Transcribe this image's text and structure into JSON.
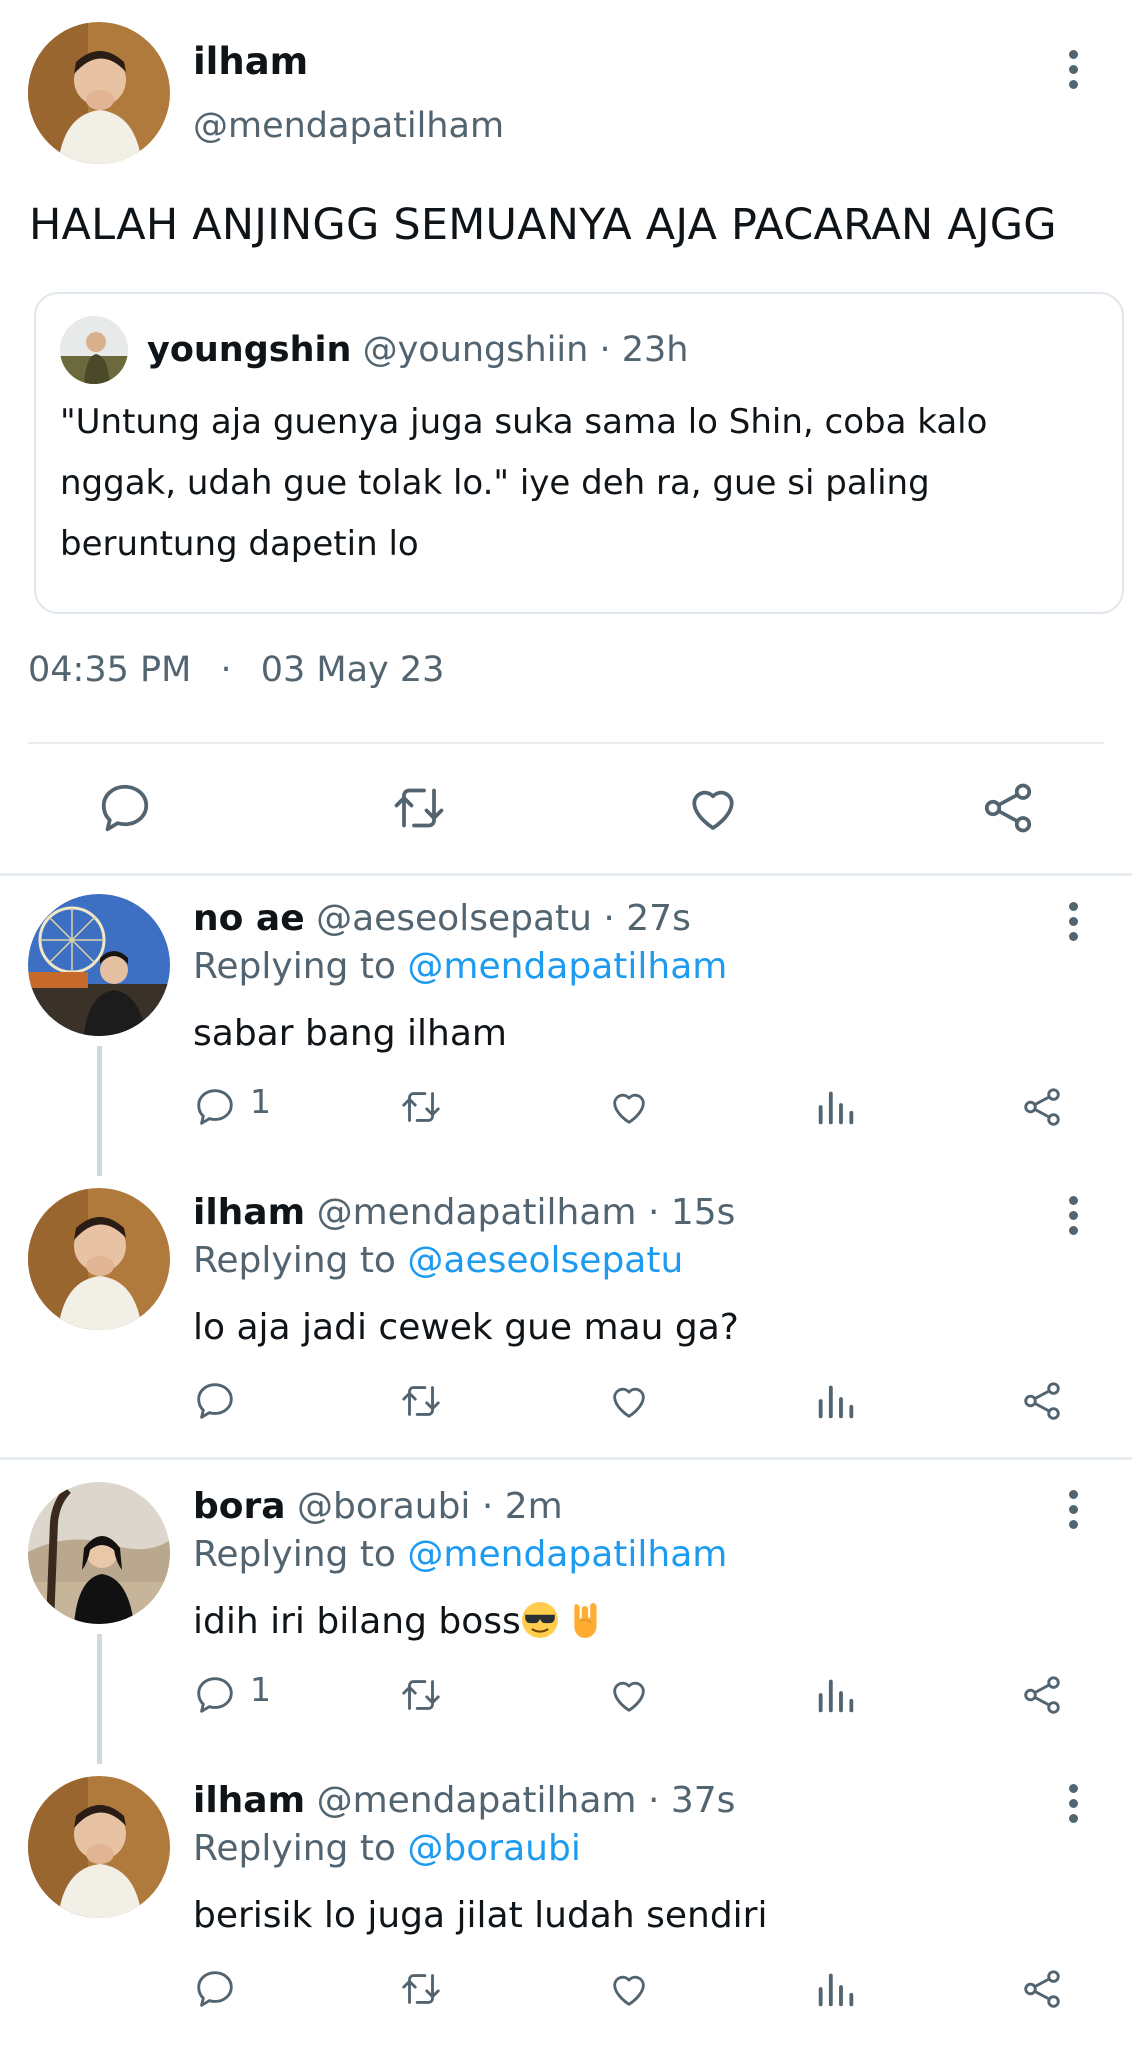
{
  "main_tweet": {
    "name": "ilham",
    "handle": "@mendapatilham",
    "text": "HALAH ANJINGG SEMUANYA AJA PACARAN AJGG",
    "quoted": {
      "name": "youngshin",
      "meta": "@youngshiin · 23h",
      "text": "\"Untung aja guenya juga suka sama lo Shin, coba kalo nggak, udah gue tolak lo.\" iye deh ra, gue si paling beruntung dapetin lo"
    },
    "time": "04:35 PM",
    "dot": "·",
    "date": "03 May 23"
  },
  "replies": [
    {
      "name": "no ae",
      "meta": "@aeseolsepatu · 27s",
      "replying_prefix": "Replying to ",
      "replying_to": "@mendapatilham",
      "text": "sabar bang ilham",
      "reply_count": "1"
    },
    {
      "name": "ilham",
      "meta": "@mendapatilham · 15s",
      "replying_prefix": "Replying to ",
      "replying_to": "@aeseolsepatu",
      "text": "lo aja jadi cewek gue mau ga?",
      "reply_count": ""
    },
    {
      "name": "bora",
      "meta": "@boraubi · 2m",
      "replying_prefix": "Replying to ",
      "replying_to": "@mendapatilham",
      "text": "idih iri bilang boss",
      "reply_count": "1",
      "emojis": [
        "sunglasses-emoji",
        "rock-on-hand-emoji"
      ]
    },
    {
      "name": "ilham",
      "meta": "@mendapatilham · 37s",
      "replying_prefix": "Replying to ",
      "replying_to": "@boraubi",
      "text": "berisik lo juga jilat ludah sendiri",
      "reply_count": ""
    }
  ],
  "icons": {
    "reply": "reply-icon",
    "retweet": "retweet-icon",
    "like": "like-icon",
    "views": "views-icon",
    "share": "share-icon",
    "more": "more-icon"
  },
  "colors": {
    "text": "#0f1419",
    "muted": "#536471",
    "link": "#1d9bf0",
    "border": "#e6ecf0"
  }
}
